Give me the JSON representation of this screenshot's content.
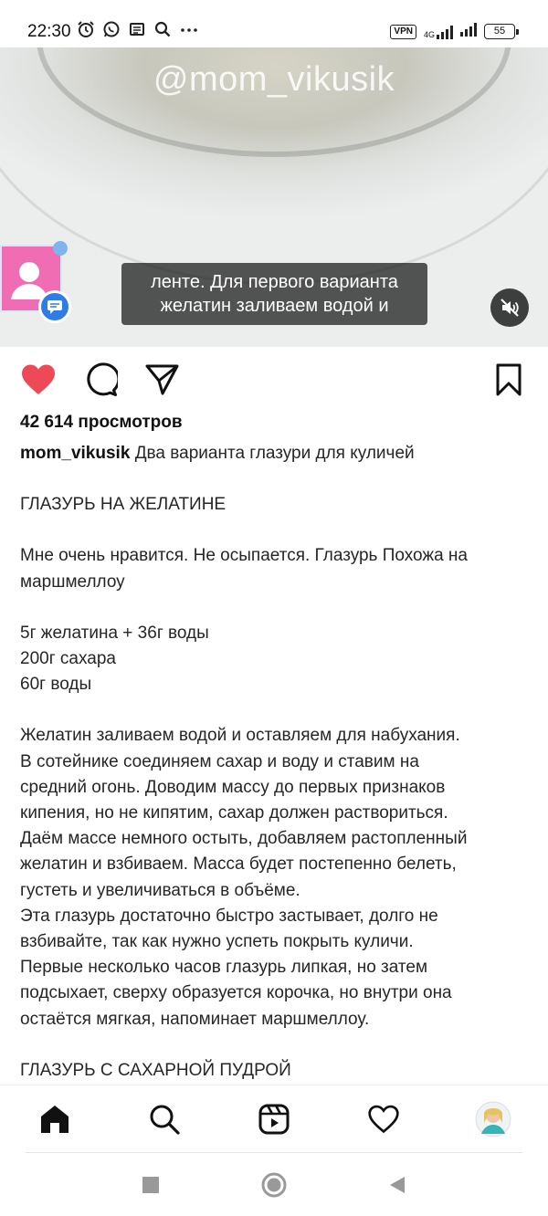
{
  "status_bar": {
    "time": "22:30",
    "vpn": "VPN",
    "network": "4G",
    "battery": "55"
  },
  "video": {
    "watermark": "@mom_vikusik",
    "subtitle_line1": "ленте. Для первого варианта",
    "subtitle_line2": "желатин заливаем водой и"
  },
  "post": {
    "views": "42 614 просмотров",
    "username": "mom_vikusik",
    "caption_title": "Два варианта глазури для куличей",
    "caption_lines": [
      "",
      "ГЛАЗУРЬ НА ЖЕЛАТИНЕ",
      "",
      "Мне очень нравится. Не осыпается. Глазурь Похожа на",
      "маршмеллоу",
      "",
      "5г желатина + 36г воды",
      "200г сахара",
      "60г воды",
      "",
      "Желатин заливаем водой и оставляем для набухания.",
      "В сотейнике соединяем сахар и воду и ставим на",
      "средний огонь. Доводим массу до первых признаков",
      "кипения, но не кипятим, сахар должен раствориться.",
      "Даём массе немного остыть, добавляем растопленный",
      "желатин и взбиваем. Масса будет постепенно белеть,",
      "густеть и увеличиваться в объёме.",
      "Эта глазурь достаточно быстро застывает, долго не",
      "взбивайте, так как нужно успеть покрыть куличи.",
      "Первые несколько часов глазурь липкая, но затем",
      "подсыхает, сверху образуется корочка, но внутри она",
      "остаётся мягкая, напоминает маршмеллоу.",
      "",
      "ГЛАЗУРЬ С САХАРНОЙ ПУДРОЙ"
    ]
  },
  "colors": {
    "like": "#ed4956",
    "text": "#262626"
  }
}
